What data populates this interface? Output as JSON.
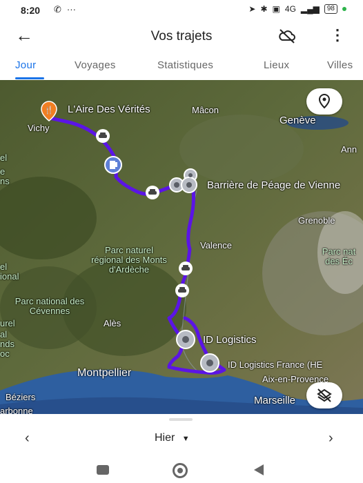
{
  "status": {
    "time": "8:20",
    "network": "4G",
    "battery": "98"
  },
  "appbar": {
    "title": "Vos trajets"
  },
  "tabs": [
    {
      "label": "Jour",
      "active": true
    },
    {
      "label": "Voyages"
    },
    {
      "label": "Statistiques"
    },
    {
      "label": "Lieux"
    },
    {
      "label": "Villes"
    }
  ],
  "map": {
    "places": {
      "aire": "L'Aire Des Vérités",
      "vichy": "Vichy",
      "macon": "Mâcon",
      "geneve": "Genève",
      "annecy_partial": "Ann",
      "peage": "Barrière de Péage de Vienne",
      "grenoble": "Grenoble",
      "valence": "Valence",
      "parc_ardeche": "Parc naturel régional des Monts d'Ardèche",
      "parc_cevennes": "Parc national des Cévennes",
      "parc_ecrins_partial": "Parc nat des Éc",
      "ales": "Alès",
      "id_logistics": "ID Logistics",
      "id_logistics_france": "ID Logistics France (HE",
      "montpellier": "Montpellier",
      "aix": "Aix-en-Provence",
      "marseille": "Marseille",
      "beziers": "Béziers",
      "narbonne_partial": "arbonne",
      "left_edge_1": "el",
      "left_edge_2": "e",
      "left_edge_3": "ns",
      "left_edge_4": "el",
      "left_edge_5": "ional",
      "left_edge_6": "urel",
      "left_edge_7": "al",
      "left_edge_8": "nds",
      "left_edge_9": "oc"
    },
    "route_color": "#5b14e6"
  },
  "bottom": {
    "day": "Hier"
  }
}
